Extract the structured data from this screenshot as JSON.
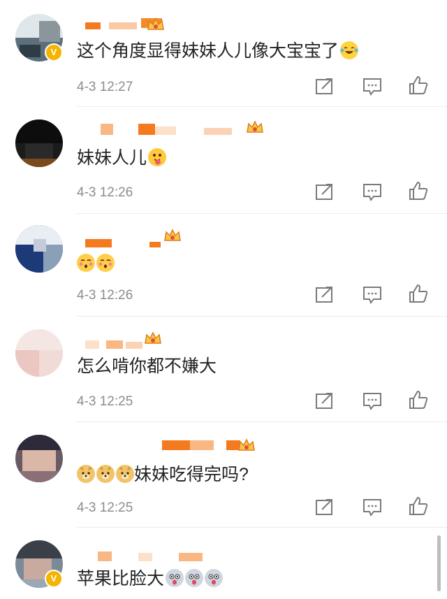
{
  "comments": [
    {
      "text": "这个角度显得妹妹人儿像大宝宝了",
      "time": "4-3 12:27",
      "verified": true,
      "emoji": [
        "laugh-tears"
      ]
    },
    {
      "text": "妹妹人儿",
      "time": "4-3 12:26",
      "verified": false,
      "emoji": [
        "tongue-face"
      ]
    },
    {
      "text": "",
      "time": "4-3 12:26",
      "verified": false,
      "emoji": [
        "blush-face",
        "blush-face"
      ]
    },
    {
      "text": "怎么啃你都不嫌大",
      "time": "4-3 12:25",
      "verified": false,
      "emoji": []
    },
    {
      "text": "妹妹吃得完吗?",
      "time": "4-3 12:25",
      "verified": false,
      "emoji": [
        "doge",
        "doge",
        "doge"
      ]
    },
    {
      "text": "苹果比脸大",
      "time": "",
      "verified": true,
      "emoji": [
        "shocked-face",
        "shocked-face",
        "shocked-face"
      ]
    }
  ],
  "icons": {
    "share": "share-icon",
    "comment": "comment-icon",
    "like": "like-icon",
    "crown": "crown-icon",
    "verified": "verified-icon"
  },
  "colors": {
    "verified_badge": "#f5b400",
    "time_text": "#8c8c8c",
    "body_text": "#222222",
    "icon_stroke": "#7a7a7a"
  }
}
